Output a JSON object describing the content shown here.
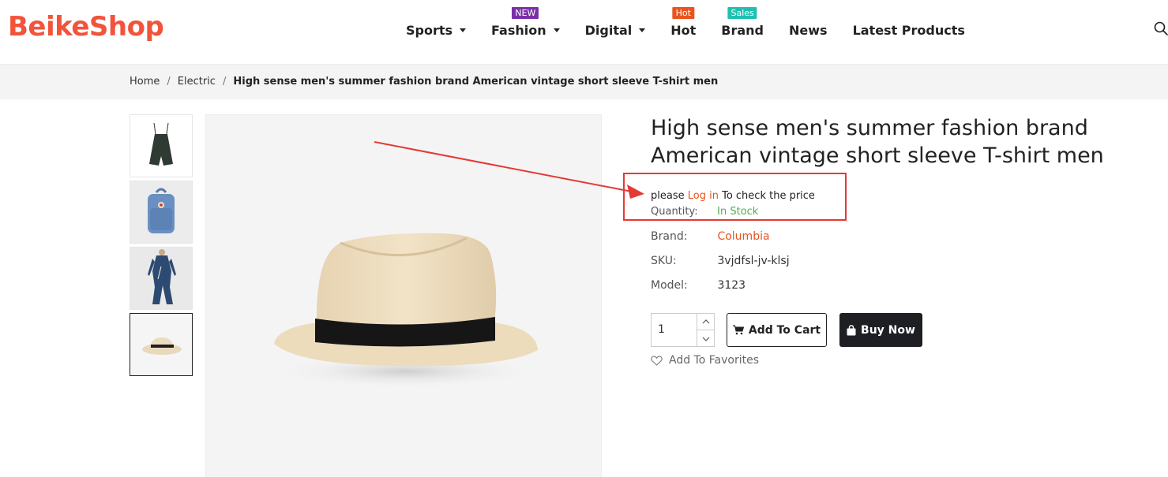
{
  "header": {
    "logo": "BeikeShop",
    "nav": [
      {
        "label": "Sports",
        "has_caret": true,
        "badge": ""
      },
      {
        "label": "Fashion",
        "has_caret": true,
        "badge": "NEW"
      },
      {
        "label": "Digital",
        "has_caret": true,
        "badge": ""
      },
      {
        "label": "Hot",
        "has_caret": false,
        "badge": "Hot"
      },
      {
        "label": "Brand",
        "has_caret": false,
        "badge": "Sales"
      },
      {
        "label": "News",
        "has_caret": false,
        "badge": ""
      },
      {
        "label": "Latest Products",
        "has_caret": false,
        "badge": ""
      }
    ],
    "search_icon": "search-icon"
  },
  "breadcrumb": {
    "items": [
      "Home",
      "Electric"
    ],
    "separator": "/",
    "current": "High sense men's summer fashion brand American vintage short sleeve T-shirt men"
  },
  "gallery": {
    "thumbnails": [
      {
        "name": "dark-green-romper"
      },
      {
        "name": "blue-backpack"
      },
      {
        "name": "denim-jumpsuit"
      },
      {
        "name": "straw-hat",
        "active": true
      }
    ],
    "main_image": "straw-hat"
  },
  "product": {
    "title": "High sense men's summer fashion brand American vintage short sleeve T-shirt men",
    "price_prefix": "please",
    "login_link": "Log in",
    "price_suffix": "To check the price",
    "quantity_label": "Quantity:",
    "quantity_status": "In Stock",
    "brand_label": "Brand:",
    "brand_value": "Columbia",
    "sku_label": "SKU:",
    "sku_value": "3vjdfsl-jv-klsj",
    "model_label": "Model:",
    "model_value": "3123",
    "quantity_value": "1",
    "add_to_cart": "Add To Cart",
    "buy_now": "Buy Now",
    "add_to_favorites": "Add To Favorites"
  },
  "colors": {
    "brand": "#f2533a",
    "accent": "#e8541e",
    "in_stock": "#4caf50",
    "annotation": "#e53935",
    "dark_button": "#1d1f22"
  }
}
